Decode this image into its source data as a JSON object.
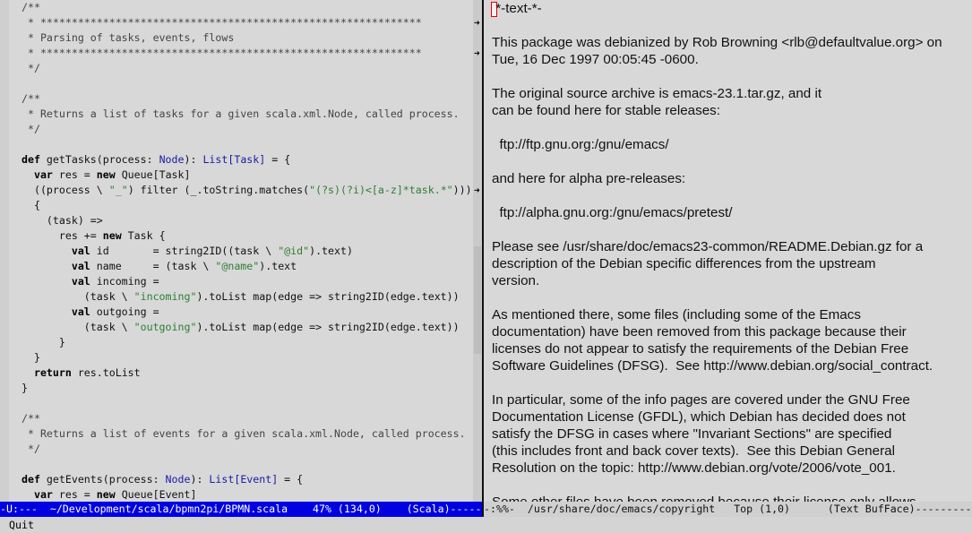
{
  "left_window": {
    "lines": [
      [
        {
          "t": "/**",
          "c": "comment"
        }
      ],
      [
        {
          "t": " * *************************************************************",
          "c": "comment"
        }
      ],
      [
        {
          "t": " * Parsing of tasks, events, flows",
          "c": "comment"
        }
      ],
      [
        {
          "t": " * *************************************************************",
          "c": "comment"
        }
      ],
      [
        {
          "t": " */",
          "c": "comment"
        }
      ],
      [],
      [
        {
          "t": "/**",
          "c": "comment"
        }
      ],
      [
        {
          "t": " * Returns a list of tasks for a given scala.xml.Node, called process.",
          "c": "comment"
        }
      ],
      [
        {
          "t": " */",
          "c": "comment"
        }
      ],
      [],
      [
        {
          "t": "def ",
          "c": "keyword"
        },
        {
          "t": "getTasks(process: ",
          "c": "plain"
        },
        {
          "t": "Node",
          "c": "type"
        },
        {
          "t": "): ",
          "c": "plain"
        },
        {
          "t": "List[Task]",
          "c": "type"
        },
        {
          "t": " = {",
          "c": "plain"
        }
      ],
      [
        {
          "t": "  var ",
          "c": "keyword"
        },
        {
          "t": "res = ",
          "c": "plain"
        },
        {
          "t": "new ",
          "c": "keyword"
        },
        {
          "t": "Queue[Task]",
          "c": "plain"
        }
      ],
      [
        {
          "t": "  ((process \\ ",
          "c": "plain"
        },
        {
          "t": "\"_\"",
          "c": "string"
        },
        {
          "t": ") filter (_.toString.matches(",
          "c": "plain"
        },
        {
          "t": "\"(?s)(?i)<[a-z]*task.*\"",
          "c": "string"
        },
        {
          "t": ")))",
          "c": "plain"
        }
      ],
      [
        {
          "t": "  {",
          "c": "plain"
        }
      ],
      [
        {
          "t": "    (task) =>",
          "c": "plain"
        }
      ],
      [
        {
          "t": "      res += ",
          "c": "plain"
        },
        {
          "t": "new ",
          "c": "keyword"
        },
        {
          "t": "Task {",
          "c": "plain"
        }
      ],
      [
        {
          "t": "        val ",
          "c": "keyword"
        },
        {
          "t": "id       = string2ID((task \\ ",
          "c": "plain"
        },
        {
          "t": "\"@id\"",
          "c": "string"
        },
        {
          "t": ").text)",
          "c": "plain"
        }
      ],
      [
        {
          "t": "        val ",
          "c": "keyword"
        },
        {
          "t": "name     = (task \\ ",
          "c": "plain"
        },
        {
          "t": "\"@name\"",
          "c": "string"
        },
        {
          "t": ").text",
          "c": "plain"
        }
      ],
      [
        {
          "t": "        val ",
          "c": "keyword"
        },
        {
          "t": "incoming =",
          "c": "plain"
        }
      ],
      [
        {
          "t": "          (task \\ ",
          "c": "plain"
        },
        {
          "t": "\"incoming\"",
          "c": "string"
        },
        {
          "t": ").toList map(edge => string2ID(edge.text))",
          "c": "plain"
        }
      ],
      [
        {
          "t": "        val ",
          "c": "keyword"
        },
        {
          "t": "outgoing =",
          "c": "plain"
        }
      ],
      [
        {
          "t": "          (task \\ ",
          "c": "plain"
        },
        {
          "t": "\"outgoing\"",
          "c": "string"
        },
        {
          "t": ").toList map(edge => string2ID(edge.text))",
          "c": "plain"
        }
      ],
      [
        {
          "t": "      }",
          "c": "plain"
        }
      ],
      [
        {
          "t": "  }",
          "c": "plain"
        }
      ],
      [
        {
          "t": "  return ",
          "c": "keyword"
        },
        {
          "t": "res.toList",
          "c": "plain"
        }
      ],
      [
        {
          "t": "}",
          "c": "plain"
        }
      ],
      [],
      [
        {
          "t": "/**",
          "c": "comment"
        }
      ],
      [
        {
          "t": " * Returns a list of events for a given scala.xml.Node, called process.",
          "c": "comment"
        }
      ],
      [
        {
          "t": " */",
          "c": "comment"
        }
      ],
      [],
      [
        {
          "t": "def ",
          "c": "keyword"
        },
        {
          "t": "getEvents(process: ",
          "c": "plain"
        },
        {
          "t": "Node",
          "c": "type"
        },
        {
          "t": "): ",
          "c": "plain"
        },
        {
          "t": "List[Event]",
          "c": "type"
        },
        {
          "t": " = {",
          "c": "plain"
        }
      ],
      [
        {
          "t": "  var ",
          "c": "keyword"
        },
        {
          "t": "res = ",
          "c": "plain"
        },
        {
          "t": "new ",
          "c": "keyword"
        },
        {
          "t": "Queue[Event]",
          "c": "plain"
        }
      ]
    ],
    "continuation_glyph": "➜",
    "continuation_lines": [
      1,
      3,
      12
    ]
  },
  "right_window": {
    "lines": [
      " *-text-*-",
      "",
      "This package was debianized by Rob Browning <rlb@defaultvalue.org> on",
      "Tue, 16 Dec 1997 00:05:45 -0600.",
      "",
      "The original source archive is emacs-23.1.tar.gz, and it",
      "can be found here for stable releases:",
      "",
      "  ftp://ftp.gnu.org:/gnu/emacs/",
      "",
      "and here for alpha pre-releases:",
      "",
      "  ftp://alpha.gnu.org:/gnu/emacs/pretest/",
      "",
      "Please see /usr/share/doc/emacs23-common/README.Debian.gz for a",
      "description of the Debian specific differences from the upstream",
      "version.",
      "",
      "As mentioned there, some files (including some of the Emacs",
      "documentation) have been removed from this package because their",
      "licenses do not appear to satisfy the requirements of the Debian Free",
      "Software Guidelines (DFSG).  See http://www.debian.org/social_contract.",
      "",
      "In particular, some of the info pages are covered under the GNU Free",
      "Documentation License (GFDL), which Debian has decided does not",
      "satisfy the DFSG in cases where \"Invariant Sections\" are specified",
      "(this includes front and back cover texts).  See this Debian General",
      "Resolution on the topic: http://www.debian.org/vote/2006/vote_001.",
      "",
      "Some other files have been removed because their license only allows"
    ]
  },
  "modeline_left": "-U:---  ~/Development/scala/bpmn2pi/BPMN.scala    47% (134,0)    (Scala)-------------------------",
  "modeline_right": "-:%%-  /usr/share/doc/emacs/copyright   Top (1,0)      (Text BufFace)---------------",
  "minibuffer": "Quit",
  "colors": {
    "modeline_active_bg": "#0000e0",
    "keyword": "#000000",
    "type": "#1a1aa8",
    "string": "#2e7d32",
    "comment": "#444444",
    "cursor": "#e00000"
  }
}
